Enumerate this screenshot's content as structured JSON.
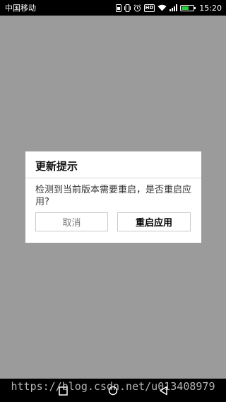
{
  "status_bar": {
    "carrier": "中国移动",
    "time": "15:20",
    "hd_label": "HD",
    "battery_level": 0.6
  },
  "dialog": {
    "title": "更新提示",
    "message": "检测到当前版本需要重启，是否重启应用?",
    "cancel_label": "取消",
    "restart_label": "重启应用"
  },
  "watermark": "https://blog.csdn.net/u013408979",
  "colors": {
    "overlay": "#9b9b9b",
    "dialog_bg": "#ffffff",
    "system_bar": "#000000",
    "battery_fill": "#2ecc40"
  },
  "icons": [
    "sim-icon",
    "vibrate-icon",
    "alarm-icon",
    "hd-icon",
    "wifi-icon",
    "signal-icon",
    "battery-icon",
    "nav-square-icon",
    "nav-home-icon",
    "nav-back-icon"
  ]
}
